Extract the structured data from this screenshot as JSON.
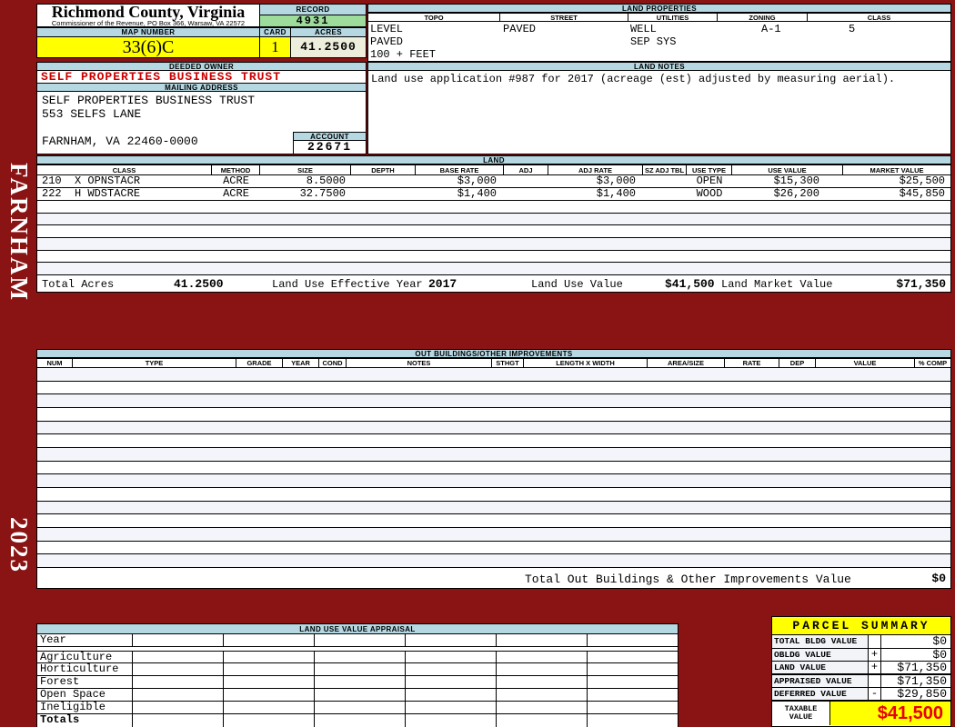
{
  "meta": {
    "county_title": "Richmond County, Virginia",
    "commissioner_line": "Commissioner of the Revenue, PO Box 366, Warsaw, VA 22572",
    "district": "FARNHAM",
    "year": "2023"
  },
  "record": {
    "label": "RECORD",
    "value": "4931"
  },
  "map": {
    "label": "MAP NUMBER",
    "value": "33(6)C"
  },
  "card": {
    "label": "CARD",
    "value": "1"
  },
  "acres": {
    "label": "ACRES",
    "value": "41.2500"
  },
  "owner": {
    "section_label": "DEEDED OWNER",
    "name": "SELF PROPERTIES BUSINESS TRUST"
  },
  "mailing": {
    "section_label": "MAILING ADDRESS",
    "line1": "SELF PROPERTIES BUSINESS TRUST",
    "line2": "553 SELFS LANE",
    "line3": "",
    "line4": "FARNHAM, VA 22460-0000"
  },
  "account": {
    "label": "ACCOUNT",
    "value": "22671"
  },
  "land_properties": {
    "section_label": "LAND PROPERTIES",
    "headers": [
      "TOPO",
      "STREET",
      "UTILITIES",
      "ZONING",
      "CLASS"
    ],
    "topo_line1": "LEVEL",
    "topo_line2": "PAVED",
    "topo_line3": "100 + FEET",
    "street": "PAVED",
    "utilities_line1": "WELL",
    "utilities_line2": "SEP SYS",
    "zoning": "A-1",
    "class": "5"
  },
  "land_notes": {
    "section_label": "LAND NOTES",
    "text": "Land use application #987 for 2017 (acreage (est) adjusted by measuring aerial)."
  },
  "land": {
    "section_label": "LAND",
    "headers": [
      "CLASS",
      "METHOD",
      "SIZE",
      "DEPTH",
      "BASE RATE",
      "ADJ",
      "ADJ RATE",
      "SZ ADJ TBL",
      "USE TYPE",
      "USE VALUE",
      "MARKET VALUE"
    ],
    "rows": [
      {
        "class": "210  X OPNSTACR",
        "method": "ACRE",
        "size": "8.5000",
        "depth": "",
        "base_rate": "$3,000",
        "adj": "",
        "adj_rate": "$3,000",
        "sz_adj_tbl": "",
        "use_type": "OPEN",
        "use_value": "$15,300",
        "market_value": "$25,500"
      },
      {
        "class": "222  H WDSTACRE",
        "method": "ACRE",
        "size": "32.7500",
        "depth": "",
        "base_rate": "$1,400",
        "adj": "",
        "adj_rate": "$1,400",
        "sz_adj_tbl": "",
        "use_type": "WOOD",
        "use_value": "$26,200",
        "market_value": "$45,850"
      }
    ],
    "totals": {
      "total_acres_label": "Total Acres",
      "total_acres": "41.2500",
      "effective_year_label": "Land Use Effective Year",
      "effective_year": "2017",
      "use_value_label": "Land Use Value",
      "use_value": "$41,500",
      "market_value_label": "Land Market Value",
      "market_value": "$71,350"
    }
  },
  "outbuildings": {
    "section_label": "OUT BUILDINGS/OTHER IMPROVEMENTS",
    "headers": [
      "NUM",
      "TYPE",
      "GRADE",
      "YEAR",
      "COND",
      "NOTES",
      "STHGT",
      "LENGTH X WIDTH",
      "AREA/SIZE",
      "RATE",
      "DEP",
      "VALUE",
      "% COMP"
    ],
    "total_label": "Total Out Buildings & Other Improvements Value",
    "total_value": "$0"
  },
  "appraisal": {
    "section_label": "LAND USE VALUE APPRAISAL",
    "row_labels": [
      "Year",
      "Agriculture",
      "Horticulture",
      "Forest",
      "Open Space",
      "Ineligible",
      "Totals"
    ]
  },
  "parcel_summary": {
    "title": "PARCEL SUMMARY",
    "rows": [
      {
        "label": "TOTAL BLDG VALUE",
        "op": "",
        "value": "$0"
      },
      {
        "label": "OBLDG VALUE",
        "op": "+",
        "value": "$0"
      },
      {
        "label": "LAND VALUE",
        "op": "+",
        "value": "$71,350"
      },
      {
        "label": "APPRAISED VALUE",
        "op": "",
        "value": "$71,350"
      },
      {
        "label": "DEFERRED VALUE",
        "op": "-",
        "value": "$29,850"
      }
    ],
    "taxable_label": "TAXABLE VALUE",
    "taxable_value": "$41,500"
  },
  "colors": {
    "background_maroon": "#8a1313",
    "section_header_blue": "#b5d8e2",
    "highlight_yellow": "#ffff00",
    "record_green": "#9edc9c",
    "acres_beige": "#eeeedd",
    "alert_red_text": "#cc0000",
    "taxable_red": "#e80000"
  }
}
